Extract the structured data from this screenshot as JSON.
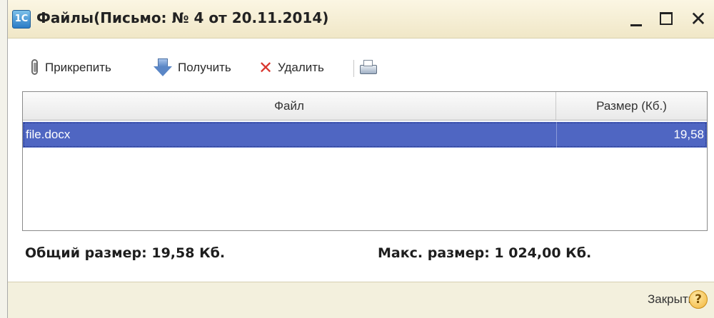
{
  "window": {
    "title": "Файлы(Письмо: № 4 от 20.11.2014)",
    "app_icon_text": "1С",
    "controls": {
      "minimize": "_",
      "maximize": "□",
      "close": "✕"
    }
  },
  "toolbar": {
    "attach_label": "Прикрепить",
    "get_label": "Получить",
    "delete_label": "Удалить",
    "icons": {
      "attach": "paperclip-icon",
      "get": "download-arrow-icon",
      "delete": "delete-x-icon",
      "print": "printer-icon"
    }
  },
  "table": {
    "columns": [
      "Файл",
      "Размер (Кб.)"
    ],
    "rows": [
      {
        "file": "file.docx",
        "size": "19,58",
        "selected": true
      }
    ]
  },
  "summary": {
    "total_size": "Общий размер: 19,58 Кб.",
    "max_size": "Макс. размер: 1 024,00 Кб."
  },
  "footer": {
    "close_label": "Закрыть",
    "help_symbol": "?"
  },
  "colors": {
    "title_bar": "#f0e7c7",
    "selection": "#4f66c2",
    "delete_icon": "#d9372f",
    "help_icon": "#f2b53a"
  }
}
